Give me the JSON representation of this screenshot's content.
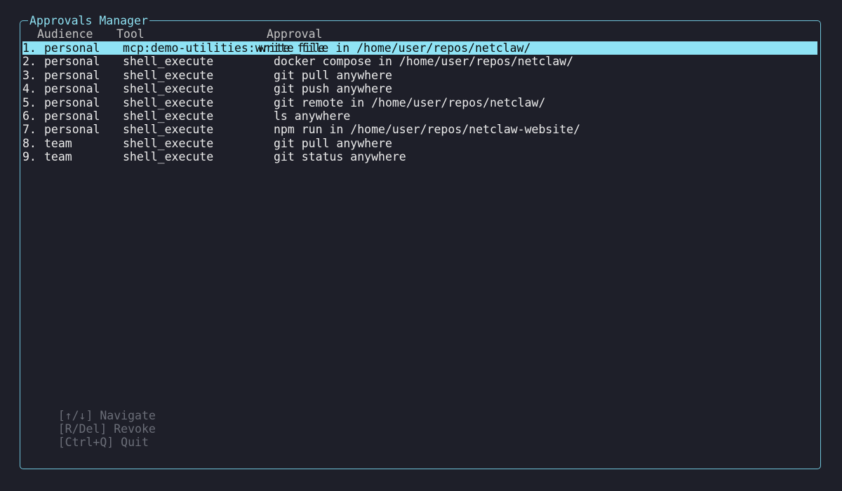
{
  "panel": {
    "title": "Approvals Manager"
  },
  "columns": {
    "audience": "Audience",
    "tool": "Tool",
    "approval": "Approval"
  },
  "rows": [
    {
      "num": "1.",
      "audience": "personal",
      "tool": "mcp:demo-utilities:write_file",
      "approval": "write_file in /home/user/repos/netclaw/",
      "selected": true
    },
    {
      "num": "2.",
      "audience": "personal",
      "tool": "shell_execute",
      "approval": "docker compose in /home/user/repos/netclaw/",
      "selected": false
    },
    {
      "num": "3.",
      "audience": "personal",
      "tool": "shell_execute",
      "approval": "git pull anywhere",
      "selected": false
    },
    {
      "num": "4.",
      "audience": "personal",
      "tool": "shell_execute",
      "approval": "git push anywhere",
      "selected": false
    },
    {
      "num": "5.",
      "audience": "personal",
      "tool": "shell_execute",
      "approval": "git remote in /home/user/repos/netclaw/",
      "selected": false
    },
    {
      "num": "6.",
      "audience": "personal",
      "tool": "shell_execute",
      "approval": "ls anywhere",
      "selected": false
    },
    {
      "num": "7.",
      "audience": "personal",
      "tool": "shell_execute",
      "approval": "npm run in /home/user/repos/netclaw-website/",
      "selected": false
    },
    {
      "num": "8.",
      "audience": "team",
      "tool": "shell_execute",
      "approval": "git pull anywhere",
      "selected": false
    },
    {
      "num": "9.",
      "audience": "team",
      "tool": "shell_execute",
      "approval": "git status anywhere",
      "selected": false
    }
  ],
  "footer": {
    "navigate": "[↑/↓] Navigate",
    "revoke": "[R/Del] Revoke",
    "quit": "[Ctrl+Q] Quit"
  },
  "colors": {
    "background": "#1e1f29",
    "border": "#6fc3d9",
    "title": "#8ddff0",
    "selected_background": "#8fe3f5",
    "footer_text": "#6b6e78"
  }
}
